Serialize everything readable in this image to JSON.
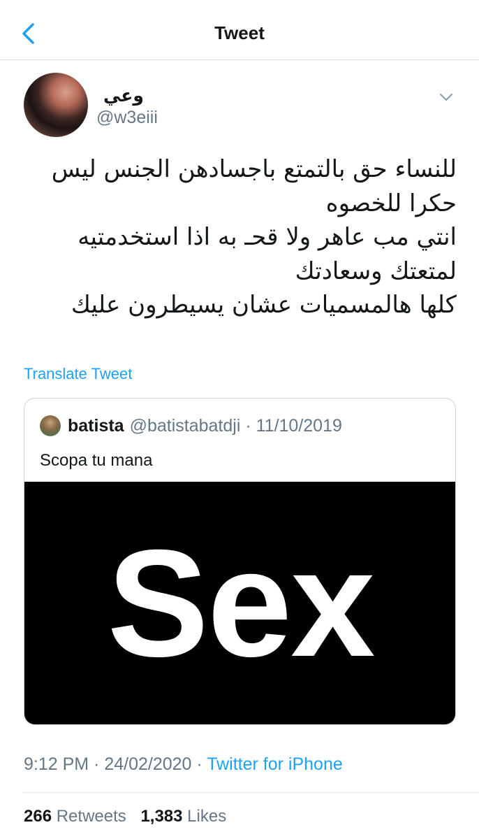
{
  "navbar": {
    "title": "Tweet",
    "back_icon": "chevron-left-icon"
  },
  "tweet": {
    "author_name": "وعي",
    "author_handle": "@w3eiii",
    "menu_icon": "chevron-down-icon",
    "text_lines": [
      "للنساء حق بالتمتع باجسادهن  الجنس ليس",
      "حكرا للخصوه",
      "انتي  مب عاهر ولا قحـ به اذا استخدمتيه",
      "لمتعتك وسعادتك",
      "كلها هالمسميات عشان يسيطرون عليك"
    ],
    "translate_label": "Translate Tweet",
    "timestamp": "9:12 PM · 24/02/2020 · ",
    "source": "Twitter for iPhone",
    "retweets_count": "266",
    "retweets_label": "Retweets",
    "likes_count": "1,383",
    "likes_label": "Likes"
  },
  "quote": {
    "name": "batista",
    "meta": "@batistabatdji · 11/10/2019",
    "text": "Scopa tu mana",
    "media_text": "Sex"
  },
  "colors": {
    "accent": "#1da1f2",
    "secondary_text": "#657786",
    "primary_text": "#14171a"
  }
}
